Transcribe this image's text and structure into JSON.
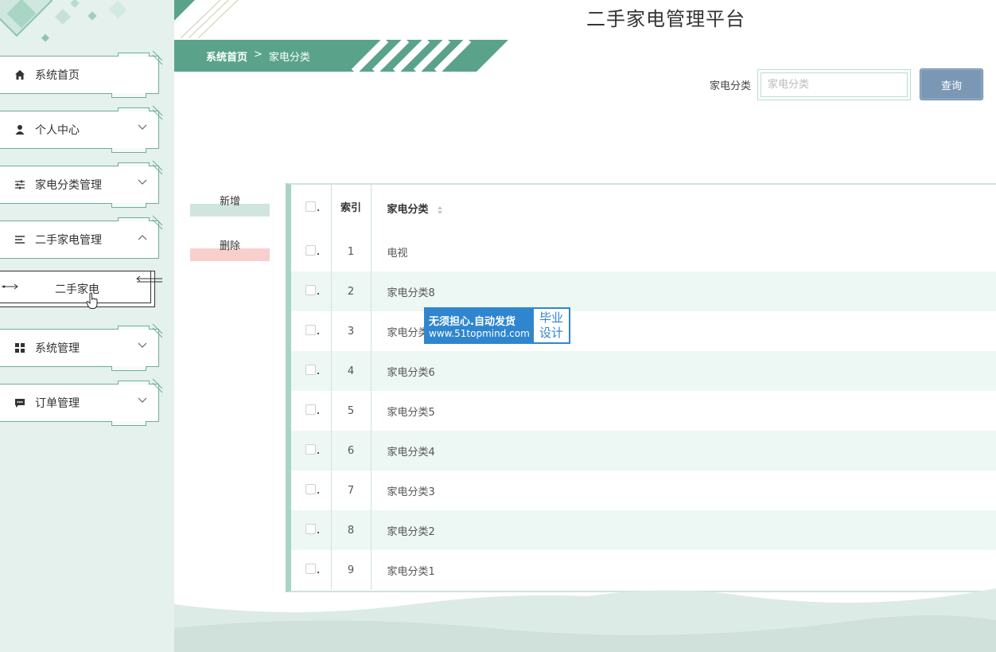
{
  "app": {
    "title": "二手家电管理平台"
  },
  "breadcrumb": {
    "home": "系统首页",
    "separator": ">",
    "current": "家电分类"
  },
  "sidebar": {
    "items": [
      {
        "label": "系统首页",
        "icon": "home-icon"
      },
      {
        "label": "个人中心",
        "icon": "user-icon"
      },
      {
        "label": "家电分类管理",
        "icon": "sliders-icon"
      },
      {
        "label": "二手家电管理",
        "icon": "list-icon"
      },
      {
        "label": "系统管理",
        "icon": "grid-icon"
      },
      {
        "label": "订单管理",
        "icon": "chat-icon"
      }
    ],
    "sub_item": {
      "label": "二手家电"
    }
  },
  "search": {
    "label": "家电分类",
    "placeholder": "家电分类",
    "button": "查询"
  },
  "actions": {
    "add": "新增",
    "delete": "删除"
  },
  "table": {
    "headers": {
      "index": "索引",
      "name": "家电分类"
    },
    "rows": [
      {
        "index": "1",
        "name": "电视"
      },
      {
        "index": "2",
        "name": "家电分类8"
      },
      {
        "index": "3",
        "name": "家电分类7"
      },
      {
        "index": "4",
        "name": "家电分类6"
      },
      {
        "index": "5",
        "name": "家电分类5"
      },
      {
        "index": "6",
        "name": "家电分类4"
      },
      {
        "index": "7",
        "name": "家电分类3"
      },
      {
        "index": "8",
        "name": "家电分类2"
      },
      {
        "index": "9",
        "name": "家电分类1"
      }
    ]
  },
  "watermark": {
    "line1": "无须担心.自动发货",
    "line2": "www.51topmind.com",
    "tag1": "毕业",
    "tag2": "设计"
  },
  "colors": {
    "accent": "#5aa38a",
    "sidebar_bg": "#e4f1ec",
    "button": "#7a98b5",
    "row_alt": "#edf7f3",
    "badge": "#2f86cf"
  }
}
